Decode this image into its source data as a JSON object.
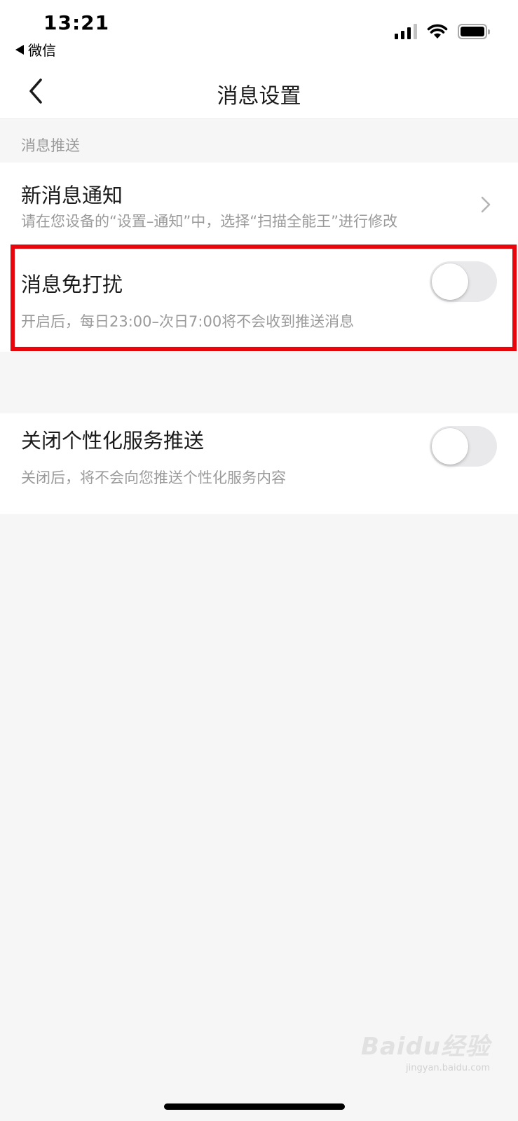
{
  "status_bar": {
    "time": "13:21",
    "back_app_label": "微信",
    "icons": [
      "cellular-signal-icon",
      "wifi-icon",
      "battery-icon"
    ]
  },
  "nav": {
    "title": "消息设置",
    "back_icon": "chevron-left-icon"
  },
  "section": {
    "header": "消息推送"
  },
  "settings": {
    "new_message_notification": {
      "title": "新消息通知",
      "subtitle": "请在您设备的“设置–通知”中，选择“扫描全能王”进行修改",
      "icon": "chevron-right-icon"
    },
    "do_not_disturb": {
      "title": "消息免打扰",
      "subtitle": "开启后，每日23:00–次日7:00将不会收到推送消息",
      "enabled": false
    },
    "personalized_push": {
      "title": "关闭个性化服务推送",
      "subtitle": "关闭后，将不会向您推送个性化服务内容",
      "enabled": false
    }
  },
  "colors": {
    "highlight": "#e8050b",
    "background": "#f6f6f6",
    "toggle_off": "#e9e9eb",
    "secondary_text": "#9a9a9a"
  },
  "watermark": {
    "main": "Baidu经验",
    "sub": "jingyan.baidu.com"
  }
}
